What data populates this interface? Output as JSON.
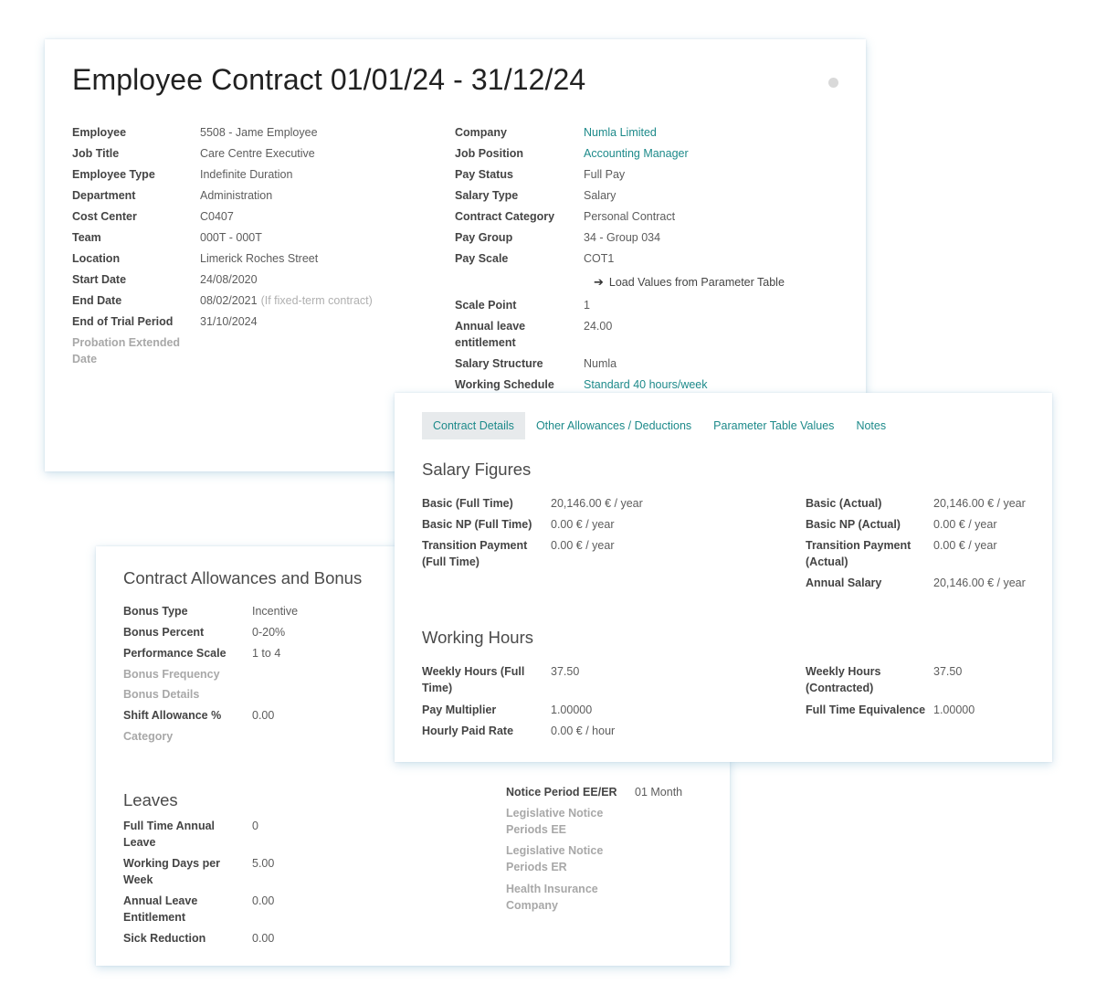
{
  "main": {
    "title": "Employee Contract 01/01/24 - 31/12/24",
    "left_fields": [
      {
        "label": "Employee",
        "value": "5508 - Jame Employee"
      },
      {
        "label": "Job Title",
        "value": "Care Centre Executive"
      },
      {
        "label": "Employee Type",
        "value": "Indefinite Duration"
      },
      {
        "label": "Department",
        "value": "Administration"
      },
      {
        "label": "Cost Center",
        "value": "C0407"
      },
      {
        "label": "Team",
        "value": "000T - 000T"
      },
      {
        "label": "Location",
        "value": "Limerick Roches Street"
      },
      {
        "label": "Start Date",
        "value": "24/08/2020"
      },
      {
        "label": "End Date",
        "value": "08/02/2021",
        "hint": "(If fixed-term contract)"
      },
      {
        "label": "End of Trial Period",
        "value": "31/10/2024"
      },
      {
        "label": "Probation Extended Date",
        "value": ""
      }
    ],
    "right_fields": [
      {
        "label": "Company",
        "value": "Numla Limited"
      },
      {
        "label": "Job Position",
        "value": "Accounting Manager"
      },
      {
        "label": "Pay Status",
        "value": "Full Pay"
      },
      {
        "label": "Salary Type",
        "value": "Salary"
      },
      {
        "label": "Contract Category",
        "value": "Personal Contract"
      },
      {
        "label": "Pay Group",
        "value": "34 - Group 034"
      },
      {
        "label": "Pay Scale",
        "value": "COT1"
      },
      {
        "label": "Scale Point",
        "value": "1"
      },
      {
        "label": "Annual leave entitlement",
        "value": "24.00"
      },
      {
        "label": "Salary Structure",
        "value": "Numla"
      },
      {
        "label": "Working Schedule",
        "value": "Standard 40 hours/week"
      }
    ],
    "load_button": "Load Values from Parameter Table",
    "colors": {
      "link": "#1d8a8a",
      "status_dot": "#d9d9d9"
    }
  },
  "details": {
    "tabs": [
      "Contract Details",
      "Other Allowances / Deductions",
      "Parameter Table Values",
      "Notes"
    ],
    "active_tab": "Contract Details",
    "salary_title": "Salary Figures",
    "salary_left": [
      {
        "label": "Basic (Full Time)",
        "value": "20,146.00 € ",
        "unit": "/ year"
      },
      {
        "label": "Basic NP (Full Time)",
        "value": "0.00 € ",
        "unit": "/ year"
      },
      {
        "label": "Transition Payment (Full Time)",
        "value": "0.00 € ",
        "unit": "/ year"
      }
    ],
    "salary_right": [
      {
        "label": "Basic (Actual)",
        "value": "20,146.00 € ",
        "unit": "/ year"
      },
      {
        "label": "Basic NP (Actual)",
        "value": "0.00 € ",
        "unit": "/ year"
      },
      {
        "label": "Transition Payment (Actual)",
        "value": "0.00 € ",
        "unit": "/ year"
      },
      {
        "label": "Annual Salary",
        "value": "20,146.00 € ",
        "unit": "/ year"
      }
    ],
    "hours_title": "Working Hours",
    "hours_left": [
      {
        "label": "Weekly Hours (Full Time)",
        "value": "37.50"
      },
      {
        "label": "Pay Multiplier",
        "value": "1.00000"
      },
      {
        "label": "Hourly Paid Rate",
        "value": "0.00 € ",
        "unit": "/ hour"
      }
    ],
    "hours_right": [
      {
        "label": "Weekly Hours (Contracted)",
        "value": "37.50"
      },
      {
        "label": "Full Time Equivalence",
        "value": "1.00000"
      }
    ]
  },
  "allowances": {
    "title": "Contract Allowances and Bonus",
    "fields": [
      {
        "label": "Bonus Type",
        "value": "Incentive"
      },
      {
        "label": "Bonus Percent",
        "value": "0-20%"
      },
      {
        "label": "Performance Scale",
        "value": "1 to 4"
      },
      {
        "label": "Bonus Frequency",
        "value": ""
      },
      {
        "label": "Bonus Details",
        "value": ""
      },
      {
        "label": "Shift Allowance %",
        "value": "0.00"
      },
      {
        "label": "Category",
        "value": ""
      }
    ],
    "leaves_title": "Leaves",
    "leaves": [
      {
        "label": "Full Time Annual Leave",
        "value": "0"
      },
      {
        "label": "Working Days per Week",
        "value": "5.00"
      },
      {
        "label": "Annual Leave Entitlement",
        "value": "0.00"
      },
      {
        "label": "Sick Reduction",
        "value": "0.00"
      }
    ],
    "notice": [
      {
        "label": "Notice Period EE/ER",
        "value": "01 Month"
      },
      {
        "label": "Legislative Notice Periods EE",
        "value": ""
      },
      {
        "label": "Legislative Notice Periods ER",
        "value": ""
      },
      {
        "label": "Health Insurance Company",
        "value": ""
      }
    ]
  }
}
